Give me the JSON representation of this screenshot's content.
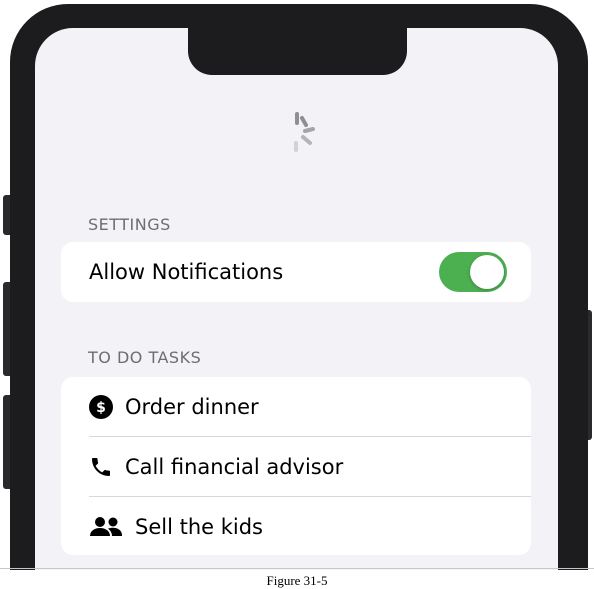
{
  "settings": {
    "header": "SETTINGS",
    "allow_notifications": {
      "label": "Allow Notifications",
      "enabled": true
    }
  },
  "tasks": {
    "header": "TO DO TASKS",
    "items": [
      {
        "label": "Order dinner",
        "icon": "dollar-circle-icon"
      },
      {
        "label": "Call financial advisor",
        "icon": "phone-icon"
      },
      {
        "label": "Sell the kids",
        "icon": "people-icon"
      }
    ]
  },
  "figure_caption": "Figure 31-5",
  "colors": {
    "toggle_on": "#4caf50",
    "background": "#f2f2f7",
    "section_header": "#6d6d72"
  }
}
